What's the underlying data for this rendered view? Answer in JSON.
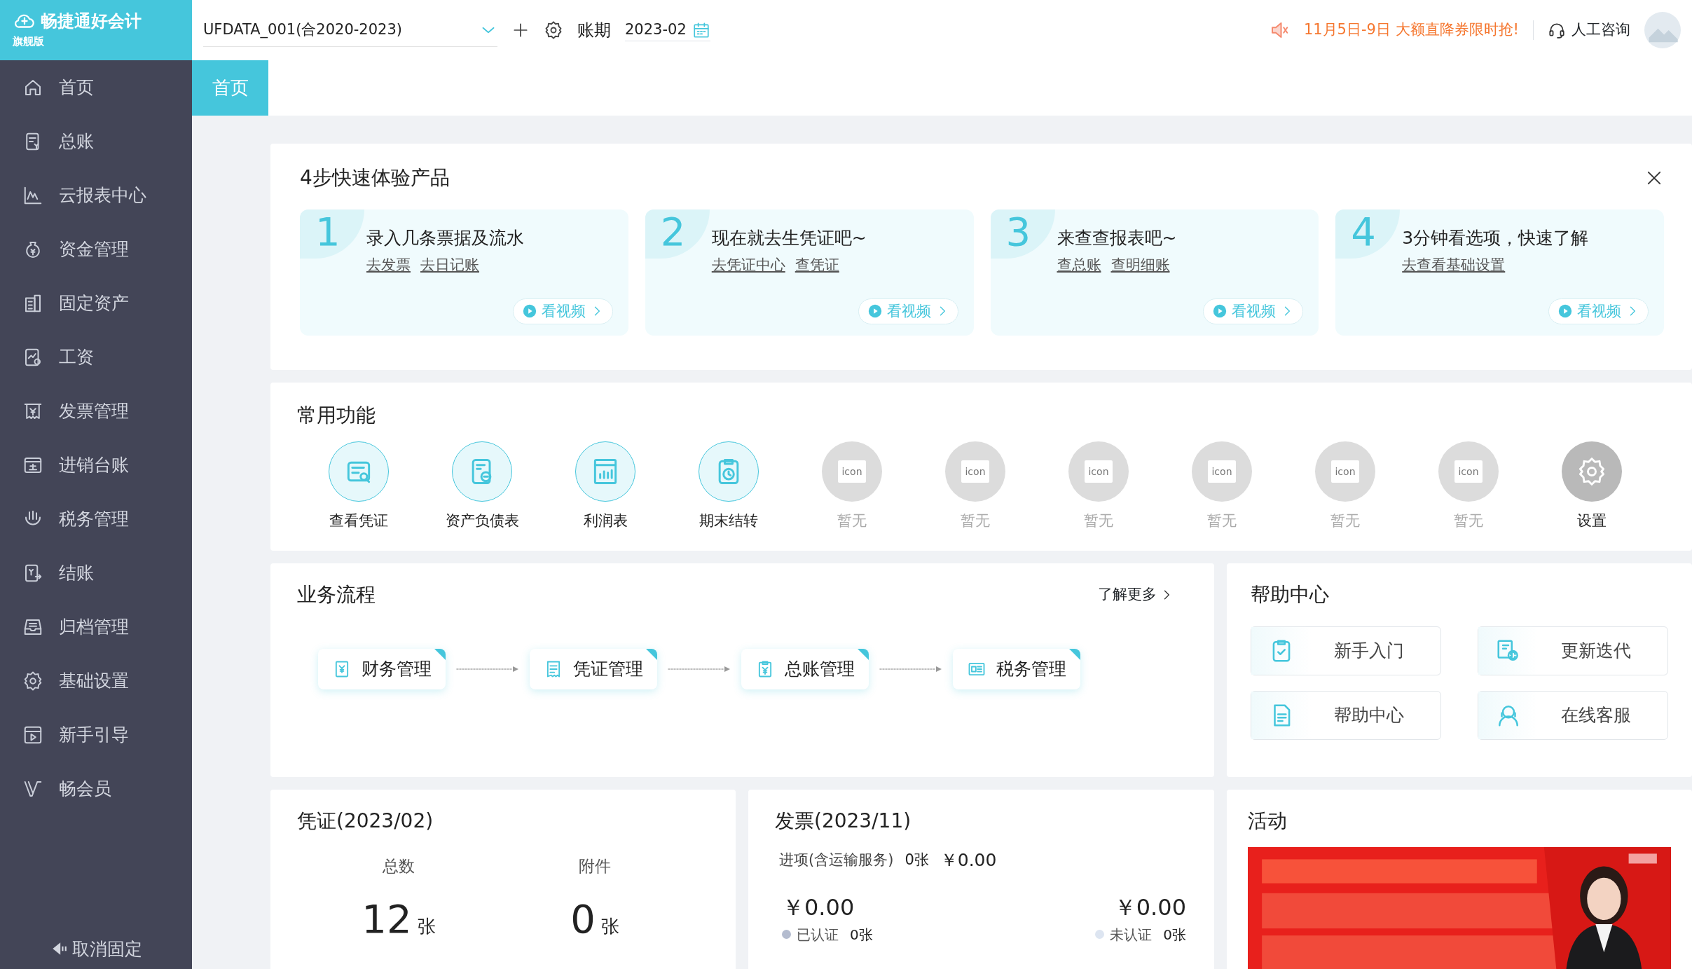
{
  "header": {
    "logo_text": "畅捷通好会计",
    "edition": "旗舰版",
    "account": "UFDATA_001(合2020-2023)",
    "period_label": "账期",
    "period": "2023-02",
    "promo": "11月5日-9日 大额直降券限时抢!",
    "support": "人工咨询"
  },
  "sidebar": {
    "items": [
      {
        "label": "首页"
      },
      {
        "label": "总账"
      },
      {
        "label": "云报表中心"
      },
      {
        "label": "资金管理"
      },
      {
        "label": "固定资产"
      },
      {
        "label": "工资"
      },
      {
        "label": "发票管理"
      },
      {
        "label": "进销台账"
      },
      {
        "label": "税务管理"
      },
      {
        "label": "结账"
      },
      {
        "label": "归档管理"
      },
      {
        "label": "基础设置"
      },
      {
        "label": "新手引导"
      },
      {
        "label": "畅会员"
      }
    ],
    "unpin": "取消固定"
  },
  "tabs": [
    {
      "label": "首页",
      "selected": true
    }
  ],
  "steps": {
    "title": "4步快速体验产品",
    "items": [
      {
        "number": "1",
        "title": "录入几条票据及流水",
        "links": [
          "去发票",
          "去日记账"
        ],
        "video": "看视频"
      },
      {
        "number": "2",
        "title": "现在就去生凭证吧~",
        "links": [
          "去凭证中心",
          "查凭证"
        ],
        "video": "看视频"
      },
      {
        "number": "3",
        "title": "来查查报表吧~",
        "links": [
          "查总账",
          "查明细账"
        ],
        "video": "看视频"
      },
      {
        "number": "4",
        "title": "3分钟看选项，快速了解",
        "links": [
          "去查看基础设置"
        ],
        "video": "看视频"
      }
    ]
  },
  "functions": {
    "title": "常用功能",
    "items": [
      {
        "label": "查看凭证",
        "kind": "active"
      },
      {
        "label": "资产负债表",
        "kind": "active"
      },
      {
        "label": "利润表",
        "kind": "active"
      },
      {
        "label": "期末结转",
        "kind": "active"
      },
      {
        "label": "暂无",
        "kind": "empty",
        "icon_text": "icon"
      },
      {
        "label": "暂无",
        "kind": "empty",
        "icon_text": "icon"
      },
      {
        "label": "暂无",
        "kind": "empty",
        "icon_text": "icon"
      },
      {
        "label": "暂无",
        "kind": "empty",
        "icon_text": "icon"
      },
      {
        "label": "暂无",
        "kind": "empty",
        "icon_text": "icon"
      },
      {
        "label": "暂无",
        "kind": "empty",
        "icon_text": "icon"
      },
      {
        "label": "设置",
        "kind": "settings"
      }
    ]
  },
  "flow": {
    "title": "业务流程",
    "more": "了解更多",
    "steps": [
      {
        "label": "财务管理"
      },
      {
        "label": "凭证管理"
      },
      {
        "label": "总账管理"
      },
      {
        "label": "税务管理"
      }
    ]
  },
  "help": {
    "title": "帮助中心",
    "items": [
      {
        "label": "新手入门"
      },
      {
        "label": "更新迭代"
      },
      {
        "label": "帮助中心"
      },
      {
        "label": "在线客服"
      }
    ]
  },
  "voucher": {
    "title": "凭证(2023/02)",
    "stats": [
      {
        "label": "总数",
        "value": "12",
        "unit": "张"
      },
      {
        "label": "附件",
        "value": "0",
        "unit": "张"
      }
    ]
  },
  "invoice": {
    "title": "发票(2023/11)",
    "input_label": "进项(含运输服务)",
    "input_count": "0张",
    "input_amount": "￥0.00",
    "groups": [
      {
        "amount": "￥0.00",
        "label": "已认证",
        "count": "0张",
        "color": "#b4bccf"
      },
      {
        "amount": "￥0.00",
        "label": "未认证",
        "count": "0张",
        "color": "#dde5f1"
      }
    ]
  },
  "activity": {
    "title": "活动"
  }
}
